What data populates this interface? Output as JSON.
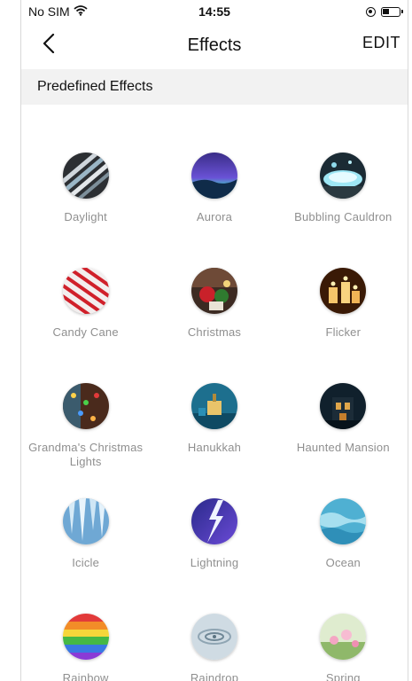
{
  "status_bar": {
    "carrier": "No SIM",
    "time": "14:55"
  },
  "nav": {
    "title": "Effects",
    "edit_label": "EDIT"
  },
  "section": {
    "title": "Predefined Effects"
  },
  "effects": [
    {
      "label": "Daylight",
      "icon": "daylight-icon"
    },
    {
      "label": "Aurora",
      "icon": "aurora-icon"
    },
    {
      "label": "Bubbling Cauldron",
      "icon": "bubbling-cauldron-icon"
    },
    {
      "label": "Candy Cane",
      "icon": "candy-cane-icon"
    },
    {
      "label": "Christmas",
      "icon": "christmas-icon"
    },
    {
      "label": "Flicker",
      "icon": "flicker-icon"
    },
    {
      "label": "Grandma's Christmas Lights",
      "icon": "grandmas-christmas-lights-icon"
    },
    {
      "label": "Hanukkah",
      "icon": "hanukkah-icon"
    },
    {
      "label": "Haunted Mansion",
      "icon": "haunted-mansion-icon"
    },
    {
      "label": "Icicle",
      "icon": "icicle-icon"
    },
    {
      "label": "Lightning",
      "icon": "lightning-icon"
    },
    {
      "label": "Ocean",
      "icon": "ocean-icon"
    },
    {
      "label": "Rainbow",
      "icon": "rainbow-icon"
    },
    {
      "label": "Raindrop",
      "icon": "raindrop-icon"
    },
    {
      "label": "Spring",
      "icon": "spring-icon"
    }
  ]
}
